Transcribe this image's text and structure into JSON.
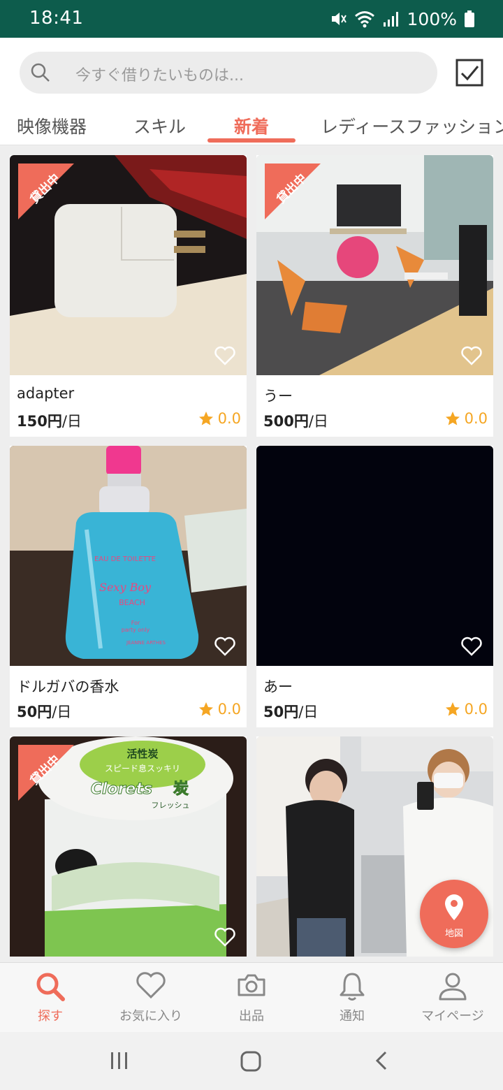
{
  "status_bar": {
    "time": "18:41",
    "battery": "100%"
  },
  "search": {
    "placeholder": "今すぐ借りたいものは..."
  },
  "tabs": [
    {
      "label": "映像機器"
    },
    {
      "label": "スキル"
    },
    {
      "label": "新着"
    },
    {
      "label": "レディースファッション"
    }
  ],
  "active_tab": "新着",
  "items": [
    {
      "name": "adapter",
      "price": "150",
      "yen": "円",
      "unit": "/日",
      "rating": "0.0",
      "badge": "貸出中"
    },
    {
      "name": "うー",
      "price": "500",
      "yen": "円",
      "unit": "/日",
      "rating": "0.0",
      "badge": "貸出中"
    },
    {
      "name": "ドルガバの香水",
      "price": "50",
      "yen": "円",
      "unit": "/日",
      "rating": "0.0"
    },
    {
      "name": "あー",
      "price": "50",
      "yen": "円",
      "unit": "/日",
      "rating": "0.0"
    },
    {
      "badge": "貸出中"
    }
  ],
  "perfume_label": {
    "line1": "EAU DE TOILETTE",
    "line2": "Sexy Boy",
    "line3": "BEACH",
    "line4": "For",
    "line5": "party only",
    "line6": "JEANNE ARTHES"
  },
  "gum_label": {
    "line1": "活性炭",
    "line2": "スピード息スッキリ",
    "line3": "Clorets",
    "line4": "炭",
    "line5": "フレッシュ"
  },
  "map_button": {
    "label": "地図"
  },
  "bottom_nav": [
    {
      "label": "探す",
      "icon": "search-icon"
    },
    {
      "label": "お気に入り",
      "icon": "heart-icon"
    },
    {
      "label": "出品",
      "icon": "camera-icon"
    },
    {
      "label": "通知",
      "icon": "bell-icon"
    },
    {
      "label": "マイページ",
      "icon": "person-icon"
    }
  ],
  "colors": {
    "accent": "#ef6c5a",
    "status_bar": "#0d5c4c",
    "star": "#f5a623"
  }
}
